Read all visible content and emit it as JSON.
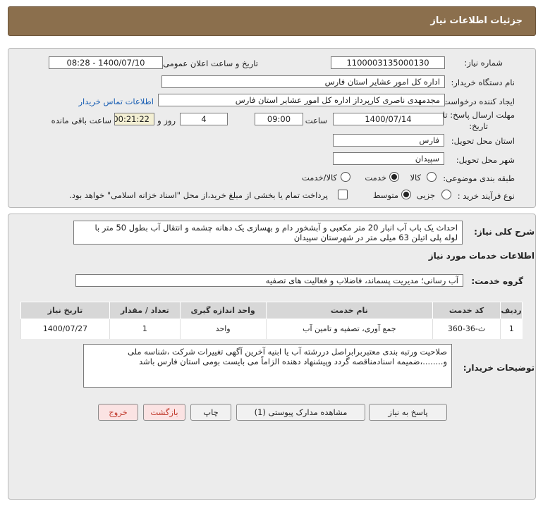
{
  "header": {
    "title": "جزئیات اطلاعات نیاز"
  },
  "info": {
    "need_number_label": "شماره نیاز:",
    "need_number": "1100003135000130",
    "announce_label": "تاریخ و ساعت اعلان عمومی:",
    "announce_value": "1400/07/10 - 08:28",
    "buyer_org_label": "نام دستگاه خریدار:",
    "buyer_org": "اداره کل امور عشایر استان فارس",
    "creator_label": "ایجاد کننده درخواست:",
    "creator": "مجدمهدی ناصری کارپرداز اداره کل امور عشایر استان فارس",
    "contact_link": "اطلاعات تماس خریدار",
    "deadline_label_1": "مهلت ارسال پاسخ: تا",
    "deadline_label_2": "تاریخ:",
    "deadline_date": "1400/07/14",
    "time_label": "ساعت",
    "deadline_time": "09:00",
    "days_value": "4",
    "days_label": "روز و",
    "remaining_time": "00:21:22",
    "remaining_label": "ساعت باقی مانده",
    "province_label": "استان محل تحویل:",
    "province": "فارس",
    "city_label": "شهر محل تحویل:",
    "city": "سپیدان",
    "category_label": "طبقه بندی موضوعی:",
    "category_options": [
      "کالا",
      "خدمت",
      "کالا/خدمت"
    ],
    "process_label": "نوع فرآیند خرید :",
    "process_options": [
      "جزیی",
      "متوسط"
    ],
    "payment_note": "پرداخت تمام یا بخشی از مبلغ خرید،از محل \"اسناد خزانه اسلامی\" خواهد بود."
  },
  "description": {
    "label": "شرح کلی نیاز:",
    "line1": "احداث یک باب آب انبار  20  متر مکعبی و آبشخور دام و بهسازی یک دهانه چشمه و انتقال آب بطول 50 متر با",
    "line2": "لوله پلی اتیلن 63 میلی متر در  شهرستان سپیدان"
  },
  "services": {
    "section_title": "اطلاعات خدمات مورد نیاز",
    "group_label": "گروه خدمت:",
    "group_value": "آب رسانی؛ مدیریت پسماند، فاضلاب و فعالیت های تصفیه",
    "columns": [
      "ردیف",
      "کد خدمت",
      "نام خدمت",
      "واحد اندازه گیری",
      "تعداد / مقدار",
      "تاریخ نیاز"
    ],
    "rows": [
      [
        "1",
        "ث-36-360",
        "جمع آوری، تصفیه و تامین آب",
        "واحد",
        "1",
        "1400/07/27"
      ]
    ]
  },
  "buyer_notes": {
    "label": "توضیحات خریدار:",
    "line1": "صلاحیت ورتبه بندی معتبربرابراصل دررشته آب یا ابنیه  آخرین آگهی تغییرات شرکت ،شناسه ملی",
    "line2": "و........،ضمیمه اسنادمناقصه گردد وپیشنهاد دهنده الزاماً می بایست بومی استان فارس باشد"
  },
  "buttons": {
    "reply": "پاسخ به نیاز",
    "view_docs": "مشاهده مدارک پیوستی (1)",
    "print": "چاپ",
    "back": "بازگشت",
    "exit": "خروج"
  }
}
